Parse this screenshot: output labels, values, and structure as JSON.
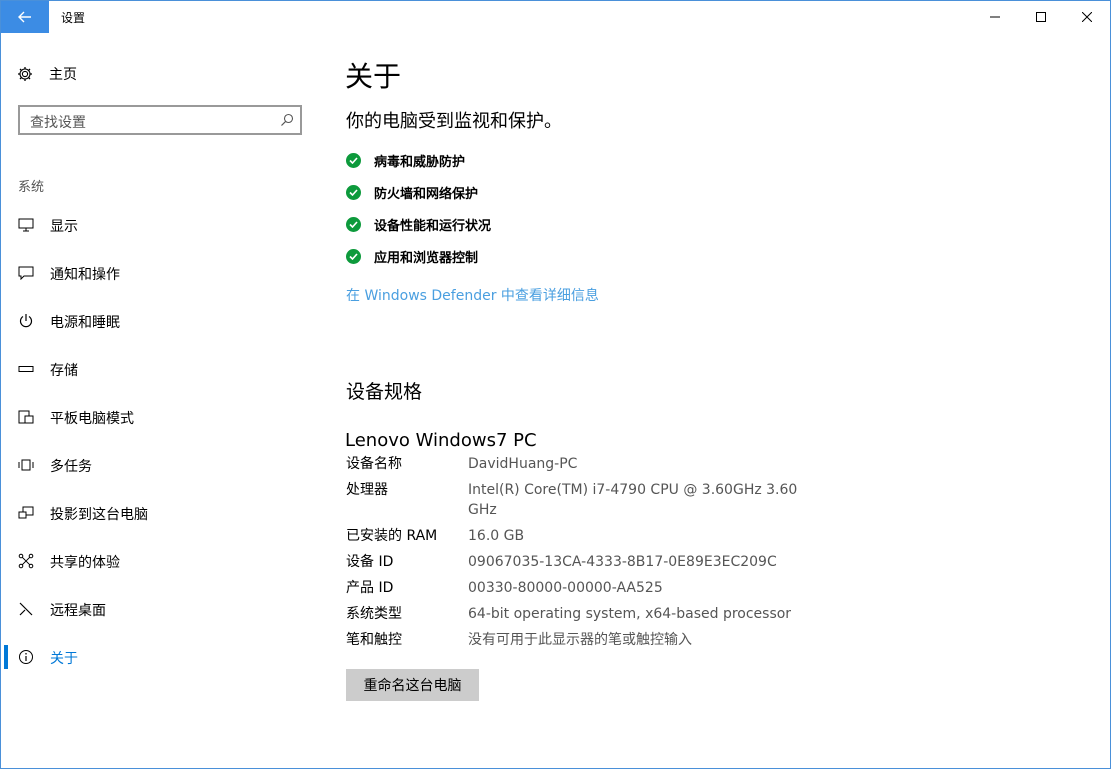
{
  "window": {
    "title": "设置"
  },
  "sidebar": {
    "home_label": "主页",
    "search_placeholder": "查找设置",
    "section_label": "系统",
    "items": [
      {
        "label": "显示",
        "icon": "monitor-icon"
      },
      {
        "label": "通知和操作",
        "icon": "notification-icon"
      },
      {
        "label": "电源和睡眠",
        "icon": "power-icon"
      },
      {
        "label": "存储",
        "icon": "storage-icon"
      },
      {
        "label": "平板电脑模式",
        "icon": "tablet-mode-icon"
      },
      {
        "label": "多任务",
        "icon": "multitasking-icon"
      },
      {
        "label": "投影到这台电脑",
        "icon": "projection-icon"
      },
      {
        "label": "共享的体验",
        "icon": "shared-experiences-icon"
      },
      {
        "label": "远程桌面",
        "icon": "remote-desktop-icon"
      },
      {
        "label": "关于",
        "icon": "info-icon",
        "active": true
      }
    ]
  },
  "main": {
    "title": "关于",
    "protection_heading": "你的电脑受到监视和保护。",
    "status_items": [
      "病毒和威胁防护",
      "防火墙和网络保护",
      "设备性能和运行状况",
      "应用和浏览器控制"
    ],
    "defender_link": "在 Windows Defender 中查看详细信息",
    "specs_heading": "设备规格",
    "device_model": "Lenovo Windows7 PC",
    "specs": [
      {
        "key": "设备名称",
        "value": "DavidHuang-PC"
      },
      {
        "key": "处理器",
        "value": "Intel(R) Core(TM) i7-4790 CPU @ 3.60GHz   3.60 GHz"
      },
      {
        "key": "已安装的 RAM",
        "value": "16.0 GB"
      },
      {
        "key": "设备 ID",
        "value": "09067035-13CA-4333-8B17-0E89E3EC209C"
      },
      {
        "key": "产品 ID",
        "value": "00330-80000-00000-AA525"
      },
      {
        "key": "系统类型",
        "value": "64-bit operating system, x64-based processor"
      },
      {
        "key": "笔和触控",
        "value": "没有可用于此显示器的笔或触控输入"
      }
    ],
    "rename_button": "重命名这台电脑"
  },
  "colors": {
    "accent": "#0078d7",
    "titlebar_back": "#3c8ce4",
    "check_green": "#0d9a3c",
    "link": "#4a9fe0"
  }
}
